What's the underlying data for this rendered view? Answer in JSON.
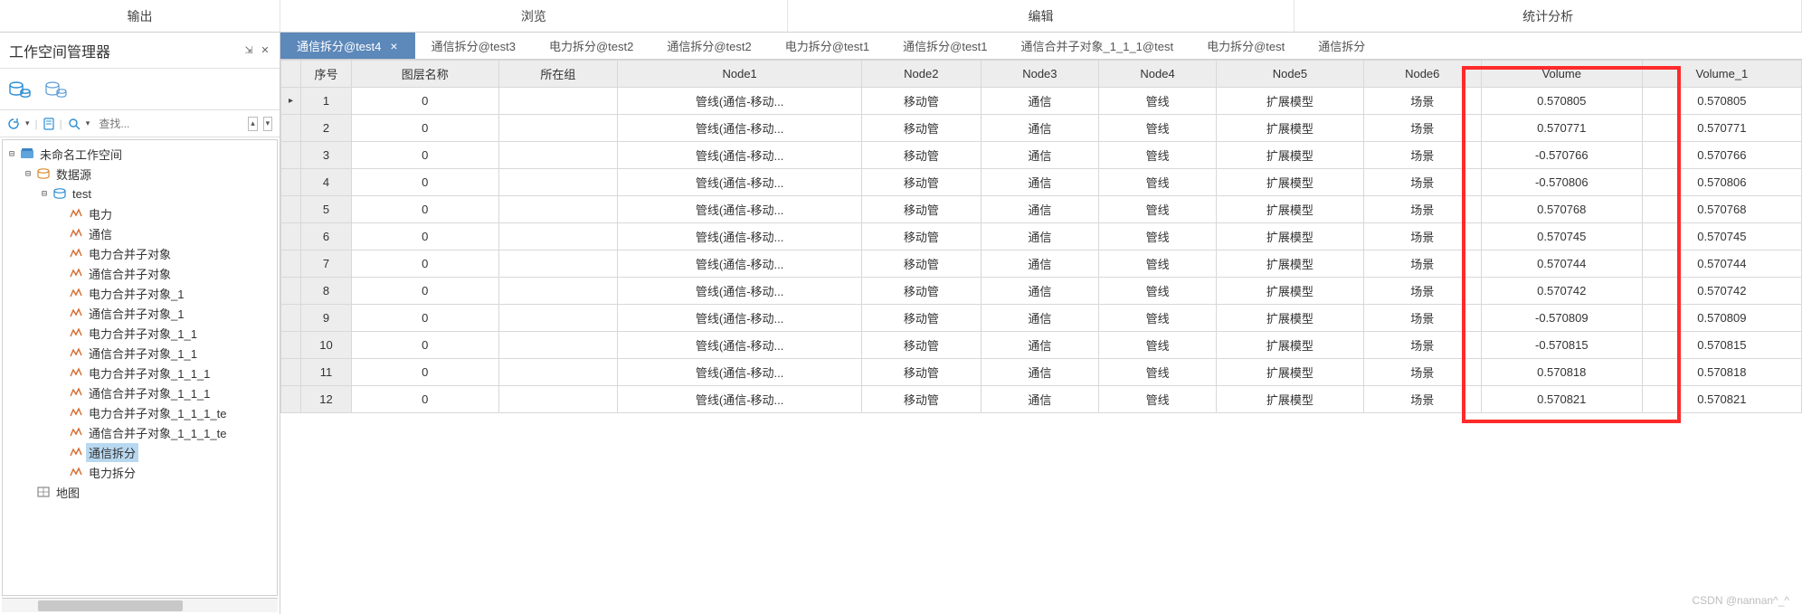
{
  "topTabs": [
    "输出",
    "浏览",
    "编辑",
    "统计分析"
  ],
  "sidebar": {
    "title": "工作空间管理器",
    "searchPlaceholder": "查找...",
    "tree": {
      "root": "未命名工作空间",
      "ds": "数据源",
      "test": "test",
      "items": [
        "电力",
        "通信",
        "电力合并子对象",
        "通信合并子对象",
        "电力合并子对象_1",
        "通信合并子对象_1",
        "电力合并子对象_1_1",
        "通信合并子对象_1_1",
        "电力合并子对象_1_1_1",
        "通信合并子对象_1_1_1",
        "电力合并子对象_1_1_1_te",
        "通信合并子对象_1_1_1_te",
        "通信拆分",
        "电力拆分"
      ],
      "selected": "通信拆分",
      "maps": "地图"
    }
  },
  "docTabs": [
    {
      "label": "通信拆分@test4",
      "active": true,
      "closable": true
    },
    {
      "label": "通信拆分@test3"
    },
    {
      "label": "电力拆分@test2"
    },
    {
      "label": "通信拆分@test2"
    },
    {
      "label": "电力拆分@test1"
    },
    {
      "label": "通信拆分@test1"
    },
    {
      "label": "通信合并子对象_1_1_1@test"
    },
    {
      "label": "电力拆分@test"
    },
    {
      "label": "通信拆分"
    }
  ],
  "table": {
    "headers": [
      "",
      "序号",
      "图层名称",
      "所在组",
      "Node1",
      "Node2",
      "Node3",
      "Node4",
      "Node5",
      "Node6",
      "Volume",
      "Volume_1"
    ],
    "rows": [
      {
        "ptr": "▸",
        "idx": "1",
        "layer": "0",
        "group": "",
        "n1": "管线(通信-移动...",
        "n2": "移动管",
        "n3": "通信",
        "n4": "管线",
        "n5": "扩展模型",
        "n6": "场景",
        "v": "0.570805",
        "v1": "0.570805"
      },
      {
        "ptr": "",
        "idx": "2",
        "layer": "0",
        "group": "",
        "n1": "管线(通信-移动...",
        "n2": "移动管",
        "n3": "通信",
        "n4": "管线",
        "n5": "扩展模型",
        "n6": "场景",
        "v": "0.570771",
        "v1": "0.570771"
      },
      {
        "ptr": "",
        "idx": "3",
        "layer": "0",
        "group": "",
        "n1": "管线(通信-移动...",
        "n2": "移动管",
        "n3": "通信",
        "n4": "管线",
        "n5": "扩展模型",
        "n6": "场景",
        "v": "-0.570766",
        "v1": "0.570766"
      },
      {
        "ptr": "",
        "idx": "4",
        "layer": "0",
        "group": "",
        "n1": "管线(通信-移动...",
        "n2": "移动管",
        "n3": "通信",
        "n4": "管线",
        "n5": "扩展模型",
        "n6": "场景",
        "v": "-0.570806",
        "v1": "0.570806"
      },
      {
        "ptr": "",
        "idx": "5",
        "layer": "0",
        "group": "",
        "n1": "管线(通信-移动...",
        "n2": "移动管",
        "n3": "通信",
        "n4": "管线",
        "n5": "扩展模型",
        "n6": "场景",
        "v": "0.570768",
        "v1": "0.570768"
      },
      {
        "ptr": "",
        "idx": "6",
        "layer": "0",
        "group": "",
        "n1": "管线(通信-移动...",
        "n2": "移动管",
        "n3": "通信",
        "n4": "管线",
        "n5": "扩展模型",
        "n6": "场景",
        "v": "0.570745",
        "v1": "0.570745"
      },
      {
        "ptr": "",
        "idx": "7",
        "layer": "0",
        "group": "",
        "n1": "管线(通信-移动...",
        "n2": "移动管",
        "n3": "通信",
        "n4": "管线",
        "n5": "扩展模型",
        "n6": "场景",
        "v": "0.570744",
        "v1": "0.570744"
      },
      {
        "ptr": "",
        "idx": "8",
        "layer": "0",
        "group": "",
        "n1": "管线(通信-移动...",
        "n2": "移动管",
        "n3": "通信",
        "n4": "管线",
        "n5": "扩展模型",
        "n6": "场景",
        "v": "0.570742",
        "v1": "0.570742"
      },
      {
        "ptr": "",
        "idx": "9",
        "layer": "0",
        "group": "",
        "n1": "管线(通信-移动...",
        "n2": "移动管",
        "n3": "通信",
        "n4": "管线",
        "n5": "扩展模型",
        "n6": "场景",
        "v": "-0.570809",
        "v1": "0.570809"
      },
      {
        "ptr": "",
        "idx": "10",
        "layer": "0",
        "group": "",
        "n1": "管线(通信-移动...",
        "n2": "移动管",
        "n3": "通信",
        "n4": "管线",
        "n5": "扩展模型",
        "n6": "场景",
        "v": "-0.570815",
        "v1": "0.570815"
      },
      {
        "ptr": "",
        "idx": "11",
        "layer": "0",
        "group": "",
        "n1": "管线(通信-移动...",
        "n2": "移动管",
        "n3": "通信",
        "n4": "管线",
        "n5": "扩展模型",
        "n6": "场景",
        "v": "0.570818",
        "v1": "0.570818"
      },
      {
        "ptr": "",
        "idx": "12",
        "layer": "0",
        "group": "",
        "n1": "管线(通信-移动...",
        "n2": "移动管",
        "n3": "通信",
        "n4": "管线",
        "n5": "扩展模型",
        "n6": "场景",
        "v": "0.570821",
        "v1": "0.570821"
      }
    ]
  },
  "watermark": "CSDN @nannan^_^"
}
